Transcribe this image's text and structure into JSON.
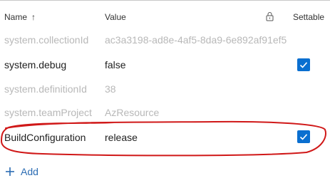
{
  "header": {
    "name_label": "Name",
    "sort_icon": "arrow-up-icon",
    "value_label": "Value",
    "lock_icon": "lock-icon",
    "settable_label": "Settable"
  },
  "rows": [
    {
      "name": "system.collectionId",
      "value": "ac3a3198-ad8e-4af5-8da9-6e892af91ef5",
      "readonly": true,
      "settable": false
    },
    {
      "name": "system.debug",
      "value": "false",
      "readonly": false,
      "settable": true
    },
    {
      "name": "system.definitionId",
      "value": "38",
      "readonly": true,
      "settable": false
    },
    {
      "name": "system.teamProject",
      "value": "AzResource",
      "readonly": true,
      "settable": false
    },
    {
      "name": "BuildConfiguration",
      "value": "release",
      "readonly": false,
      "settable": true,
      "highlighted": true
    }
  ],
  "add": {
    "label": "Add",
    "icon": "plus-icon"
  },
  "colors": {
    "accent": "#0a6fd0",
    "link": "#2b6cb3",
    "highlight_ring": "#d01818",
    "disabled_text": "#b8b8b8",
    "text": "#1e1e1e"
  }
}
